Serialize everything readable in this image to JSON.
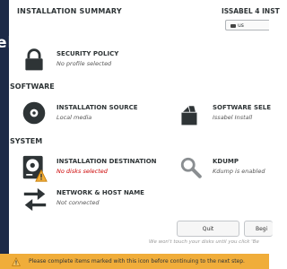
{
  "sidebar": {
    "brand": "el"
  },
  "header": {
    "title": "INSTALLATION SUMMARY",
    "product": "ISSABEL 4 INST",
    "keyboard_layout": "us"
  },
  "sections": {
    "software": "SOFTWARE",
    "system": "SYSTEM"
  },
  "spokes": {
    "security_policy": {
      "title": "SECURITY POLICY",
      "status": "No profile selected"
    },
    "installation_source": {
      "title": "INSTALLATION SOURCE",
      "status": "Local media"
    },
    "software_selection": {
      "title": "SOFTWARE SELE",
      "status": "Issabel Install"
    },
    "installation_destination": {
      "title": "INSTALLATION DESTINATION",
      "status": "No disks selected"
    },
    "kdump": {
      "title": "KDUMP",
      "status": "Kdump is enabled"
    },
    "network": {
      "title": "NETWORK & HOST NAME",
      "status": "Not connected"
    }
  },
  "buttons": {
    "quit": "Quit",
    "begin": "Begi"
  },
  "hint": "We won't touch your disks until you click 'Be",
  "warning": "Please complete items marked with this icon before continuing to the next step.",
  "colors": {
    "sidebar": "#1d2a47",
    "warning_bar": "#f0ad3a",
    "error_text": "#cc0000",
    "icon": "#2e3436",
    "icon_inactive": "#8a8e91"
  }
}
